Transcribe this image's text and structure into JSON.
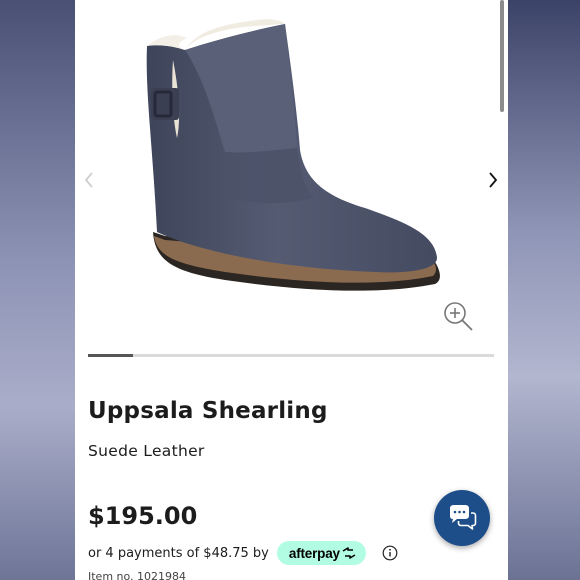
{
  "product": {
    "name": "Uppsala Shearling",
    "material": "Suede Leather",
    "price": "$195.00",
    "item_number": "Item no. 1021984"
  },
  "payment": {
    "installments_text": "or 4 payments of $48.75 by",
    "provider_label": "afterpay"
  },
  "gallery": {
    "progress": 0.11
  },
  "icons": {
    "prev": "chevron-left-icon",
    "next": "chevron-right-icon",
    "zoom": "zoom-in-icon",
    "info": "info-icon",
    "chat": "chat-bubbles-icon"
  },
  "colors": {
    "chat_button": "#1d4e8a",
    "afterpay_badge": "#b2fce4",
    "boot": "#4a5068"
  }
}
